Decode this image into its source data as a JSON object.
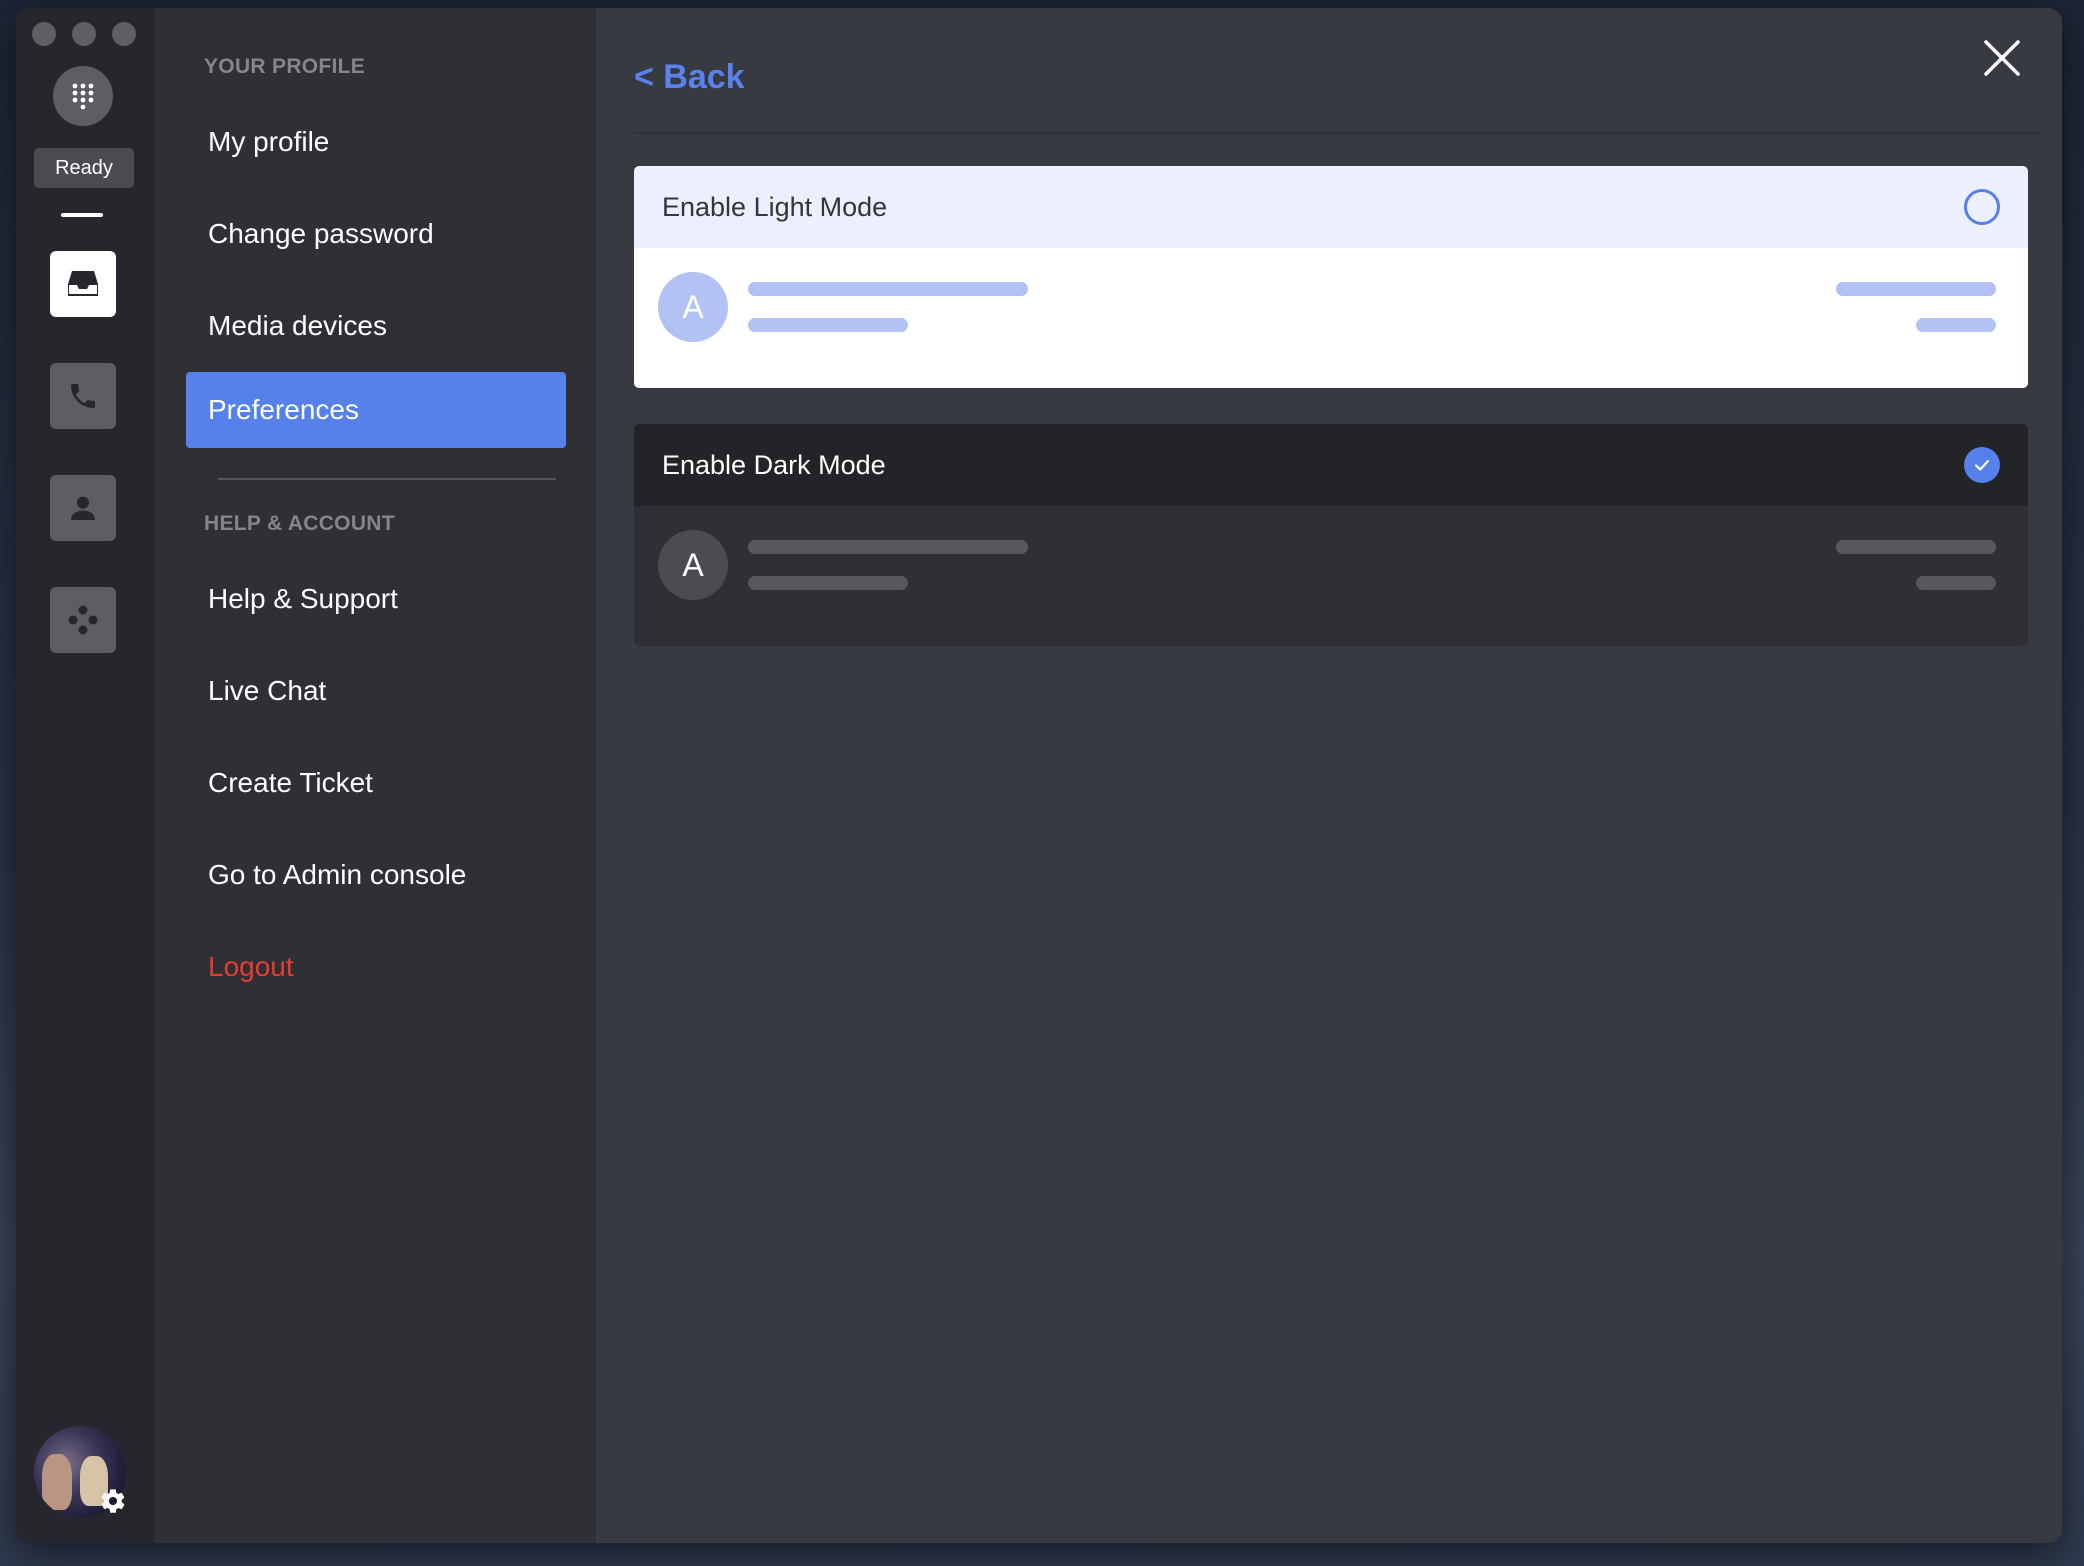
{
  "app": {
    "status_label": "Ready"
  },
  "rail": {
    "items": [
      {
        "icon": "inbox-icon",
        "active": true
      },
      {
        "icon": "phone-icon",
        "active": false
      },
      {
        "icon": "contacts-icon",
        "active": false
      },
      {
        "icon": "integrations-icon",
        "active": false
      }
    ]
  },
  "menu": {
    "profile_section": "YOUR PROFILE",
    "profile_items": [
      "My profile",
      "Change password",
      "Media devices",
      "Preferences"
    ],
    "selected_item": "Preferences",
    "help_section": "HELP & ACCOUNT",
    "help_items": [
      "Help & Support",
      "Live Chat",
      "Create Ticket",
      "Go to Admin console"
    ],
    "logout_label": "Logout"
  },
  "main": {
    "back_label": "< Back",
    "themes": {
      "light": {
        "label": "Enable Light Mode",
        "selected": false,
        "preview_avatar": "A"
      },
      "dark": {
        "label": "Enable Dark Mode",
        "selected": true,
        "preview_avatar": "A"
      }
    }
  },
  "colors": {
    "accent": "#5680ea",
    "logout": "#ea3b30",
    "sidebar": "#2e3036",
    "background": "#383a41"
  }
}
